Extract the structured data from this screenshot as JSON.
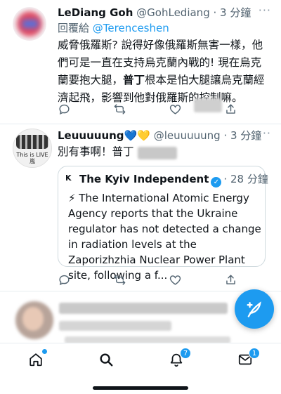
{
  "tweet1": {
    "display_name": "LeDiang Goh",
    "handle": "@GohLediang",
    "time": "· 3 分鐘",
    "reply_prefix": "回覆給 ",
    "reply_to": "@Terenceshen",
    "text_before_bold": "威脅俄羅斯? 說得好像俄羅斯無害一樣，他們可是一直在支持烏克蘭內戰的! 現在烏克蘭要抱大腿，",
    "bold_text": "普丁",
    "text_after_bold": "根本是怕大腿讓烏克蘭經濟起飛，影響到他對俄羅斯的控制嘛。"
  },
  "tweet2": {
    "display_name": "Leuuuuung",
    "name_emojis": "💙💛",
    "handle": "@leuuuuung",
    "time": "· 3 分鐘",
    "text": "別有事啊！普丁",
    "avatar_caption": "This is LIVE 嵐"
  },
  "quote": {
    "logo": "K",
    "display_name": "The Kyiv Independent",
    "verified": "✓",
    "time": "· 28 分鐘",
    "text": "⚡ The International Atomic Energy Agency reports that the Ukraine regulator has not detected a change in radiation levels at the Zaporizhzhia Nuclear Power Plant site, following a f..."
  },
  "tabbar": {
    "notifications_badge": "7",
    "messages_badge": "1"
  },
  "icons": {
    "reply": "reply-icon",
    "retweet": "retweet-icon",
    "like": "heart-icon",
    "share": "share-icon",
    "home": "home-icon",
    "search": "search-icon",
    "notifications": "bell-icon",
    "messages": "mail-icon",
    "compose": "feather-compose-icon"
  },
  "colors": {
    "accent": "#1d9bf0",
    "text": "#0f1419",
    "secondary": "#536471"
  }
}
